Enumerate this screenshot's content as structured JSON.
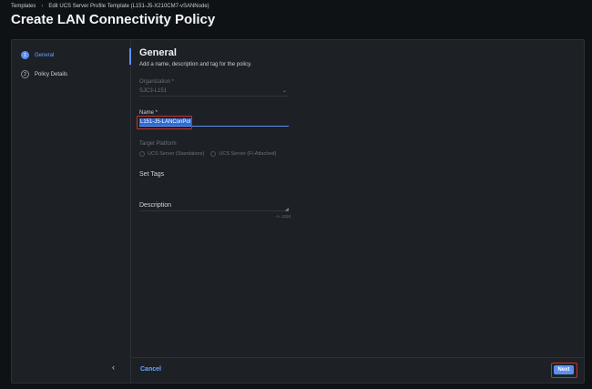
{
  "breadcrumb": {
    "items": [
      "Templates",
      "Edit UCS Server Profile Template (L151-J5-X210CM7-vSANNode)"
    ]
  },
  "page_title": "Create LAN Connectivity Policy",
  "sidebar": {
    "steps": [
      {
        "number": "1",
        "label": "General",
        "active": true
      },
      {
        "number": "2",
        "label": "Policy Details",
        "active": false
      }
    ],
    "collapse_icon": "chevron-left-icon"
  },
  "general": {
    "title": "General",
    "subtitle": "Add a name, description and tag for the policy.",
    "organization": {
      "label": "Organization *",
      "value": "SJC3-L151"
    },
    "name": {
      "label": "Name *",
      "value": "L151-J5-LANConPol"
    },
    "target_platform": {
      "label": "Target Platform",
      "options": [
        "UCS Server (Standalone)",
        "UCS Server (FI-Attached)"
      ],
      "selected": "UCS Server (FI-Attached)"
    },
    "set_tags_label": "Set Tags",
    "description": {
      "label": "Description",
      "counter": "<= 1024"
    }
  },
  "footer": {
    "cancel_label": "Cancel",
    "next_label": "Next"
  },
  "colors": {
    "accent": "#5b90ef",
    "highlight_box": "#c8302b",
    "background": "#0f1215",
    "panel": "#1d2126"
  }
}
